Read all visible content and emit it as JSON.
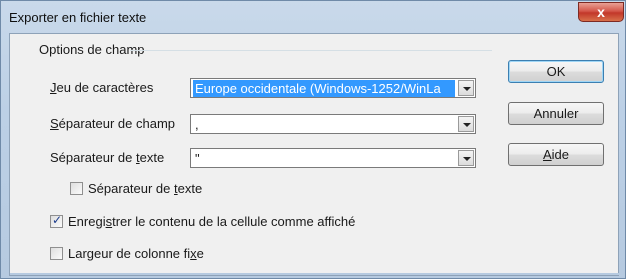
{
  "window": {
    "title": "Exporter en fichier texte",
    "close_glyph": "x"
  },
  "group": {
    "title": "Options de champ"
  },
  "fields": {
    "charset": {
      "label_pre": "",
      "label_u": "J",
      "label_post": "eu de caractères",
      "value": "Europe occidentale (Windows-1252/WinLa"
    },
    "field_sep": {
      "label_pre": "",
      "label_u": "S",
      "label_post": "éparateur de champ",
      "value": ","
    },
    "text_sep": {
      "label_pre": "Séparateur de ",
      "label_u": "t",
      "label_post": "exte",
      "value": "\""
    }
  },
  "checkboxes": {
    "text_sep": {
      "label_pre": "Séparateur de ",
      "label_u": "t",
      "label_post": "exte",
      "checked": false
    },
    "save_as_shown": {
      "label_pre": "Enregi",
      "label_u": "s",
      "label_post": "trer le contenu de la cellule comme affiché",
      "checked": true
    },
    "fixed_width": {
      "label_pre": "Largeur de colonne fi",
      "label_u": "x",
      "label_post": "e",
      "checked": false
    }
  },
  "buttons": {
    "ok": "OK",
    "cancel": "Annuler",
    "help_u": "A",
    "help_rest": "ide"
  },
  "icons": {
    "close": "close-icon",
    "dropdown": "chevron-down-icon",
    "checkmark": "checkmark-icon"
  },
  "colors": {
    "selection": "#3399ff",
    "close_button": "#c2372a",
    "frame": "#bcd0e6"
  }
}
